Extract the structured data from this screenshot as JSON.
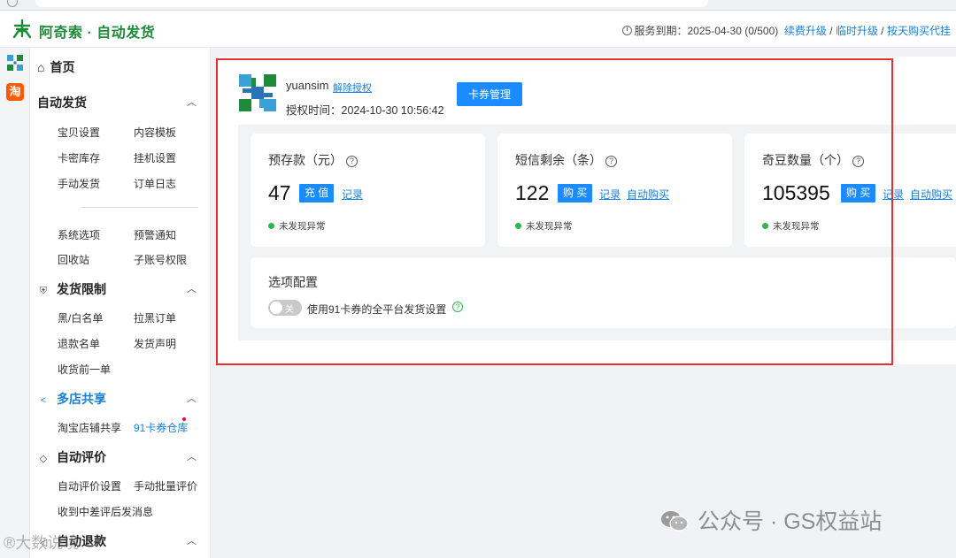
{
  "header": {
    "brand": "阿奇索 · 自动发货",
    "service_label": "服务到期：",
    "service_date": "2025-04-30 (0/500)",
    "renew": "续费升级",
    "temp_upgrade": "临时升级",
    "daily_buy": "按天购买代挂",
    "separator": " / "
  },
  "rail": {
    "taobao": "淘"
  },
  "sidebar": {
    "home": "首页",
    "groups": [
      {
        "label": "自动发货",
        "items": [
          "宝贝设置",
          "内容模板",
          "卡密库存",
          "挂机设置",
          "手动发货",
          "订单日志",
          "系统选项",
          "预警通知",
          "回收站",
          "子账号权限"
        ]
      },
      {
        "label": "发货限制",
        "items": [
          "黑/白名单",
          "拉黑订单",
          "退款名单",
          "发货声明",
          "收货前一单"
        ]
      },
      {
        "label": "多店共享",
        "items": [
          "淘宝店铺共享",
          "91卡券仓库"
        ]
      },
      {
        "label": "自动评价",
        "items": [
          "自动评价设置",
          "手动批量评价",
          "收到中差评后发消息"
        ]
      },
      {
        "label": "自动退款",
        "items": []
      }
    ]
  },
  "account": {
    "username": "yuansim",
    "unbind": "解除授权",
    "auth_time": "授权时间：2024-10-30 10:56:42",
    "card_manage": "卡券管理"
  },
  "stats": [
    {
      "title": "预存款（元）",
      "value": "47",
      "action": "充 值",
      "links": [
        "记录"
      ],
      "status": "未发现异常"
    },
    {
      "title": "短信剩余（条）",
      "value": "122",
      "action": "购 买",
      "links": [
        "记录",
        "自动购买"
      ],
      "status": "未发现异常"
    },
    {
      "title": "奇豆数量（个）",
      "value": "105395",
      "action": "购 买",
      "links": [
        "记录",
        "自动购买"
      ],
      "status": "未发现异常"
    }
  ],
  "options": {
    "title": "选项配置",
    "toggle_text": "关",
    "toggle_on": false,
    "label": "使用91卡券的全平台发货设置"
  },
  "watermark": {
    "right": "公众号 · GS权益站",
    "left": "®大数说境"
  },
  "colors": {
    "brand": "#1e8a3a",
    "link": "#1a7fd6",
    "button": "#1a8cff",
    "ok": "#2bb84c",
    "highlight_box": "#e43232"
  }
}
